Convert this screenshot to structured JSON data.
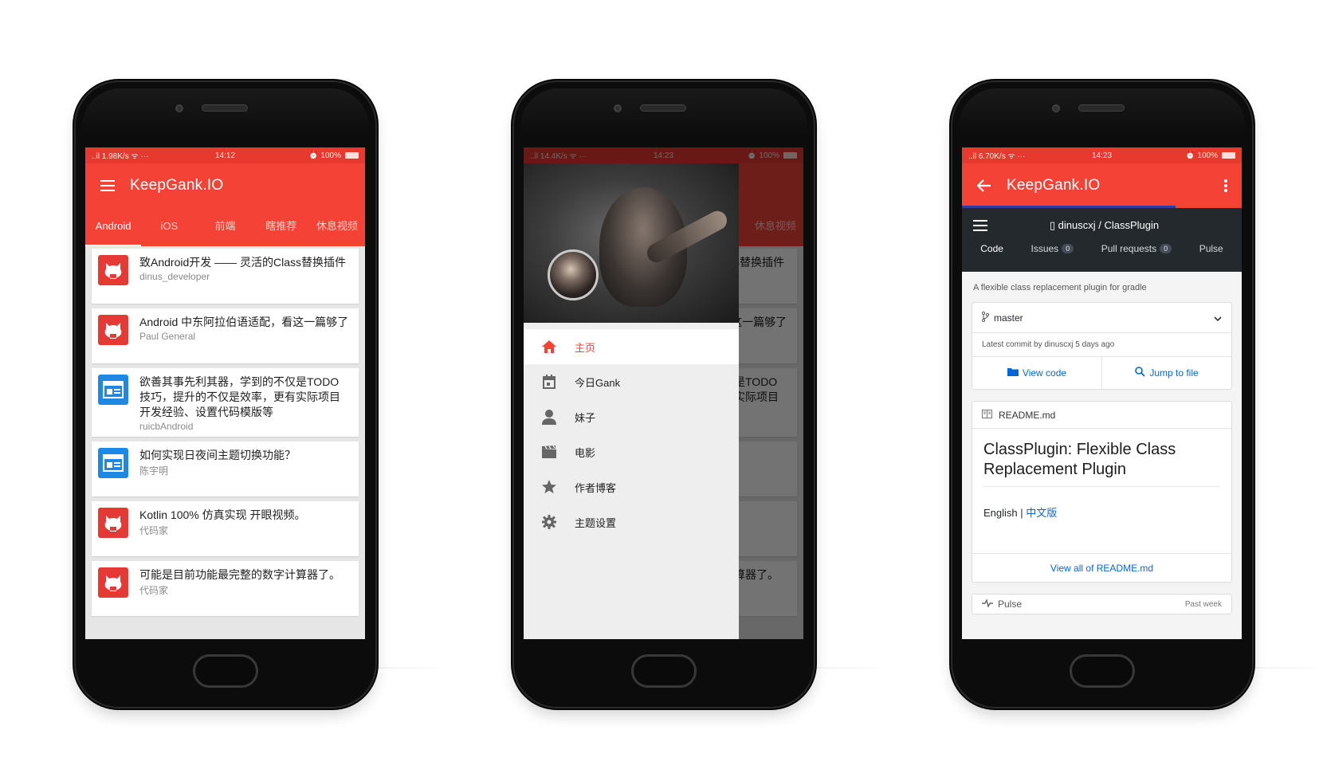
{
  "screen1": {
    "status": {
      "left": "..il 1.98K/s ᯤ ···",
      "time": "14:12",
      "right": "⏰ 100%"
    },
    "app_title": "KeepGank.IO",
    "tabs": [
      "Android",
      "iOS",
      "前端",
      "瞎推荐",
      "休息视频"
    ],
    "cards": [
      {
        "title": "致Android开发 —— 灵活的Class替换插件",
        "author": "dinus_developer",
        "icon": "github-icon"
      },
      {
        "title": "Android 中东阿拉伯语适配，看这一篇够了",
        "author": "Paul General",
        "icon": "github-icon"
      },
      {
        "title": "欲善其事先利其器，学到的不仅是TODO 技巧，提升的不仅是效率，更有实际项目开发经验、设置代码模版等",
        "author": "ruicbAndroid",
        "icon": "web-icon"
      },
      {
        "title": "如何实现日夜间主题切换功能？",
        "author": "陈宇明",
        "icon": "web-icon"
      },
      {
        "title": "Kotlin 100% 仿真实现 开眼视频。",
        "author": "代码家",
        "icon": "github-icon"
      },
      {
        "title": "可能是目前功能最完整的数字计算器了。",
        "author": "代码家",
        "icon": "github-icon"
      }
    ]
  },
  "screen2": {
    "status": {
      "left": "..il 14.4K/s ᯤ ···",
      "time": "14:23",
      "right": "⏰ 100%"
    },
    "menu": [
      {
        "label": "主页",
        "icon": "home-icon",
        "active": true
      },
      {
        "label": "今日Gank",
        "icon": "calendar-icon",
        "active": false
      },
      {
        "label": "妹子",
        "icon": "person-icon",
        "active": false
      },
      {
        "label": "电影",
        "icon": "movie-icon",
        "active": false
      },
      {
        "label": "作者博客",
        "icon": "star-icon",
        "active": false
      },
      {
        "label": "主题设置",
        "icon": "gear-icon",
        "active": false
      }
    ]
  },
  "screen3": {
    "status": {
      "left": "..il 6.70K/s ᯤ ···",
      "time": "14:23",
      "right": "⏰ 100%"
    },
    "app_title": "KeepGank.IO",
    "repo": "dinuscxj / ClassPlugin",
    "tabs": [
      {
        "label": "Code",
        "count": null
      },
      {
        "label": "Issues",
        "count": "0"
      },
      {
        "label": "Pull requests",
        "count": "0"
      },
      {
        "label": "Pulse",
        "count": null
      }
    ],
    "description": "A flexible class replacement plugin for gradle",
    "branch": "master",
    "latest_commit": "Latest commit by dinuscxj 5 days ago",
    "view_code": "View code",
    "jump_to_file": "Jump to file",
    "readme_file": "README.md",
    "readme_title": "ClassPlugin: Flexible Class Replacement Plugin",
    "lang_en": "English",
    "lang_sep": "|",
    "lang_zh": "中文版",
    "view_all": "View all of README.md",
    "pulse": "Pulse",
    "pulse_period": "Past week"
  },
  "colors": {
    "accent": "#f44336",
    "github_dark": "#24292e",
    "link": "#0366d6"
  }
}
